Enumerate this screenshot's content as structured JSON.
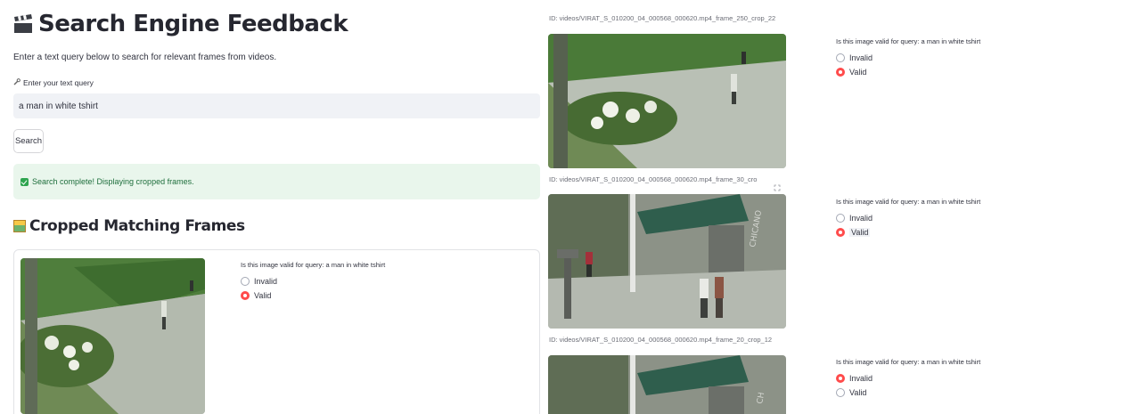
{
  "page": {
    "title": "Search Engine Feedback",
    "intro": "Enter a text query below to search for relevant frames from videos.",
    "query_label": "Enter your text query",
    "query_value": "a man in white tshirt",
    "search_button": "Search",
    "success_message": "Search complete! Displaying cropped frames.",
    "section_title": "Cropped Matching Frames"
  },
  "feedback": {
    "question": "Is this image valid for query: a man in white tshirt",
    "option_invalid": "Invalid",
    "option_valid": "Valid"
  },
  "results": [
    {
      "id": "",
      "selected": "Valid"
    },
    {
      "id": "ID: videos/VIRAT_S_010200_04_000568_000620.mp4_frame_250_crop_22",
      "selected": "Valid"
    },
    {
      "id": "ID: videos/VIRAT_S_010200_04_000568_000620.mp4_frame_30_cro",
      "selected": "Valid"
    },
    {
      "id": "ID: videos/VIRAT_S_010200_04_000568_000620.mp4_frame_20_crop_12",
      "selected": "Invalid"
    }
  ],
  "colors": {
    "accent": "#ff4b4b",
    "input_bg": "#f0f2f6",
    "success_bg": "#e9f6ec",
    "success_text": "#1e6e3c"
  },
  "icons": [
    "clapperboard-icon",
    "wrench-icon",
    "check-icon",
    "framed-picture-icon",
    "expand-icon"
  ]
}
